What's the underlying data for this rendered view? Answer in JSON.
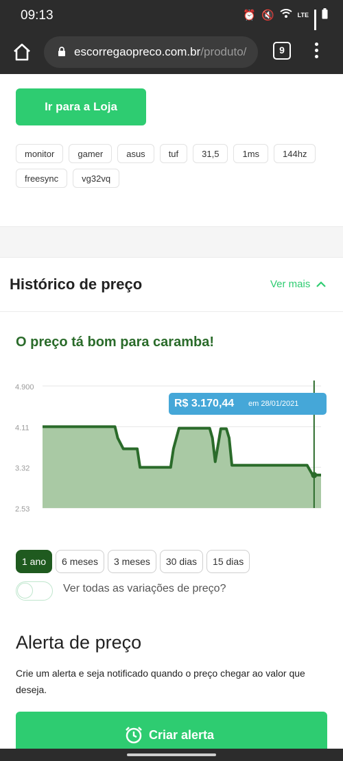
{
  "statusbar": {
    "time": "09:13",
    "network_label": "LTE"
  },
  "browser": {
    "url_domain": "escorregaopreco.com.br",
    "url_path": "/produto/",
    "tab_count": "9"
  },
  "store_button": {
    "label": "Ir para a Loja"
  },
  "tags": [
    "monitor",
    "gamer",
    "asus",
    "tuf",
    "31,5",
    "1ms",
    "144hz",
    "freesync",
    "vg32vq"
  ],
  "history": {
    "title": "Histórico de preço",
    "see_more": "Ver mais",
    "verdict": "O preço tá bom para caramba!"
  },
  "chart_data": {
    "type": "area",
    "yticks": [
      "4.900",
      "4.11",
      "3.32",
      "2.53"
    ],
    "ylim": [
      2530,
      4900
    ],
    "x": [
      0,
      26,
      27,
      29,
      34,
      35,
      46,
      47,
      49,
      50,
      52,
      53,
      54,
      55,
      60,
      61,
      62,
      64,
      66,
      67,
      68,
      69,
      70,
      71,
      72,
      73,
      77,
      83,
      89,
      95,
      97,
      98,
      100
    ],
    "values": [
      4110,
      4110,
      3890,
      3680,
      3680,
      3320,
      3320,
      3680,
      4080,
      4080,
      4080,
      4080,
      4080,
      4080,
      4080,
      3890,
      3430,
      4070,
      4070,
      3890,
      3360,
      3360,
      3360,
      3360,
      3360,
      3360,
      3360,
      3360,
      3360,
      3360,
      3170,
      3170,
      3170
    ],
    "color": "#2a6b2a",
    "fill": "#a9c9a4",
    "tooltip": {
      "price": "R$ 3.170,44",
      "date": "em 28/01/2021"
    }
  },
  "periods": [
    "1 ano",
    "6 meses",
    "3 meses",
    "30 dias",
    "15 dias"
  ],
  "active_period": "1 ano",
  "toggle": {
    "label": "Ver todas as variações de preço?"
  },
  "alert": {
    "title": "Alerta de preço",
    "description": "Crie um alerta e seja notificado quando o preço chegar ao valor que deseja.",
    "button_label": "Criar alerta"
  }
}
